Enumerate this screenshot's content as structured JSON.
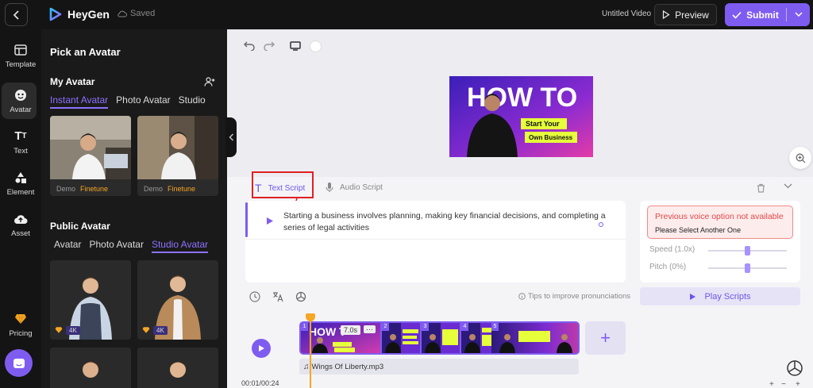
{
  "header": {
    "logo_text": "HeyGen",
    "saved_label": "Saved",
    "video_title": "Untitled Video",
    "preview_label": "Preview",
    "submit_label": "Submit"
  },
  "nav": {
    "items": [
      {
        "label": "Template",
        "icon": "template-icon"
      },
      {
        "label": "Avatar",
        "icon": "avatar-icon"
      },
      {
        "label": "Text",
        "icon": "text-icon"
      },
      {
        "label": "Element",
        "icon": "element-icon"
      },
      {
        "label": "Asset",
        "icon": "asset-icon"
      },
      {
        "label": "Pricing",
        "icon": "diamond-icon"
      }
    ]
  },
  "avatar_panel": {
    "title": "Pick an Avatar",
    "my_avatar": {
      "title": "My Avatar",
      "tabs": [
        "Instant Avatar",
        "Photo Avatar",
        "Studio"
      ],
      "cards": [
        {
          "tag": "Demo",
          "status": "Finetune"
        },
        {
          "tag": "Demo",
          "status": "Finetune"
        }
      ]
    },
    "public_avatar": {
      "title": "Public Avatar",
      "tabs": [
        "Avatar",
        "Photo Avatar",
        "Studio Avatar"
      ],
      "cards": [
        {
          "badge": "4K"
        },
        {
          "badge": "4K"
        }
      ]
    }
  },
  "canvas": {
    "thumb_title": "HOW TO",
    "thumb_line1": "Start Your",
    "thumb_line2": "Own Business"
  },
  "script": {
    "tabs": [
      "Text Script",
      "Audio Script"
    ],
    "text": "Starting a business involves planning, making key financial decisions, and completing a series of legal activities",
    "tips": "Tips to improve pronunciations"
  },
  "voice": {
    "alert_title": "Previous voice option not available",
    "alert_sub": "Please Select Another One",
    "speed_label": "Speed (1.0x)",
    "speed_value": 0.5,
    "pitch_label": "Pitch (0%)",
    "pitch_value": 0.5,
    "play_label": "Play Scripts"
  },
  "timeline": {
    "time": "00:01/00:24",
    "clip_duration": "7.0s",
    "clip_numbers": [
      "1",
      "2",
      "3",
      "4",
      "5"
    ],
    "clip1_title": "HOW T",
    "audio_track": "Wings Of Liberty.mp3"
  },
  "colors": {
    "accent": "#7f5cf0",
    "alert": "#e24848"
  }
}
